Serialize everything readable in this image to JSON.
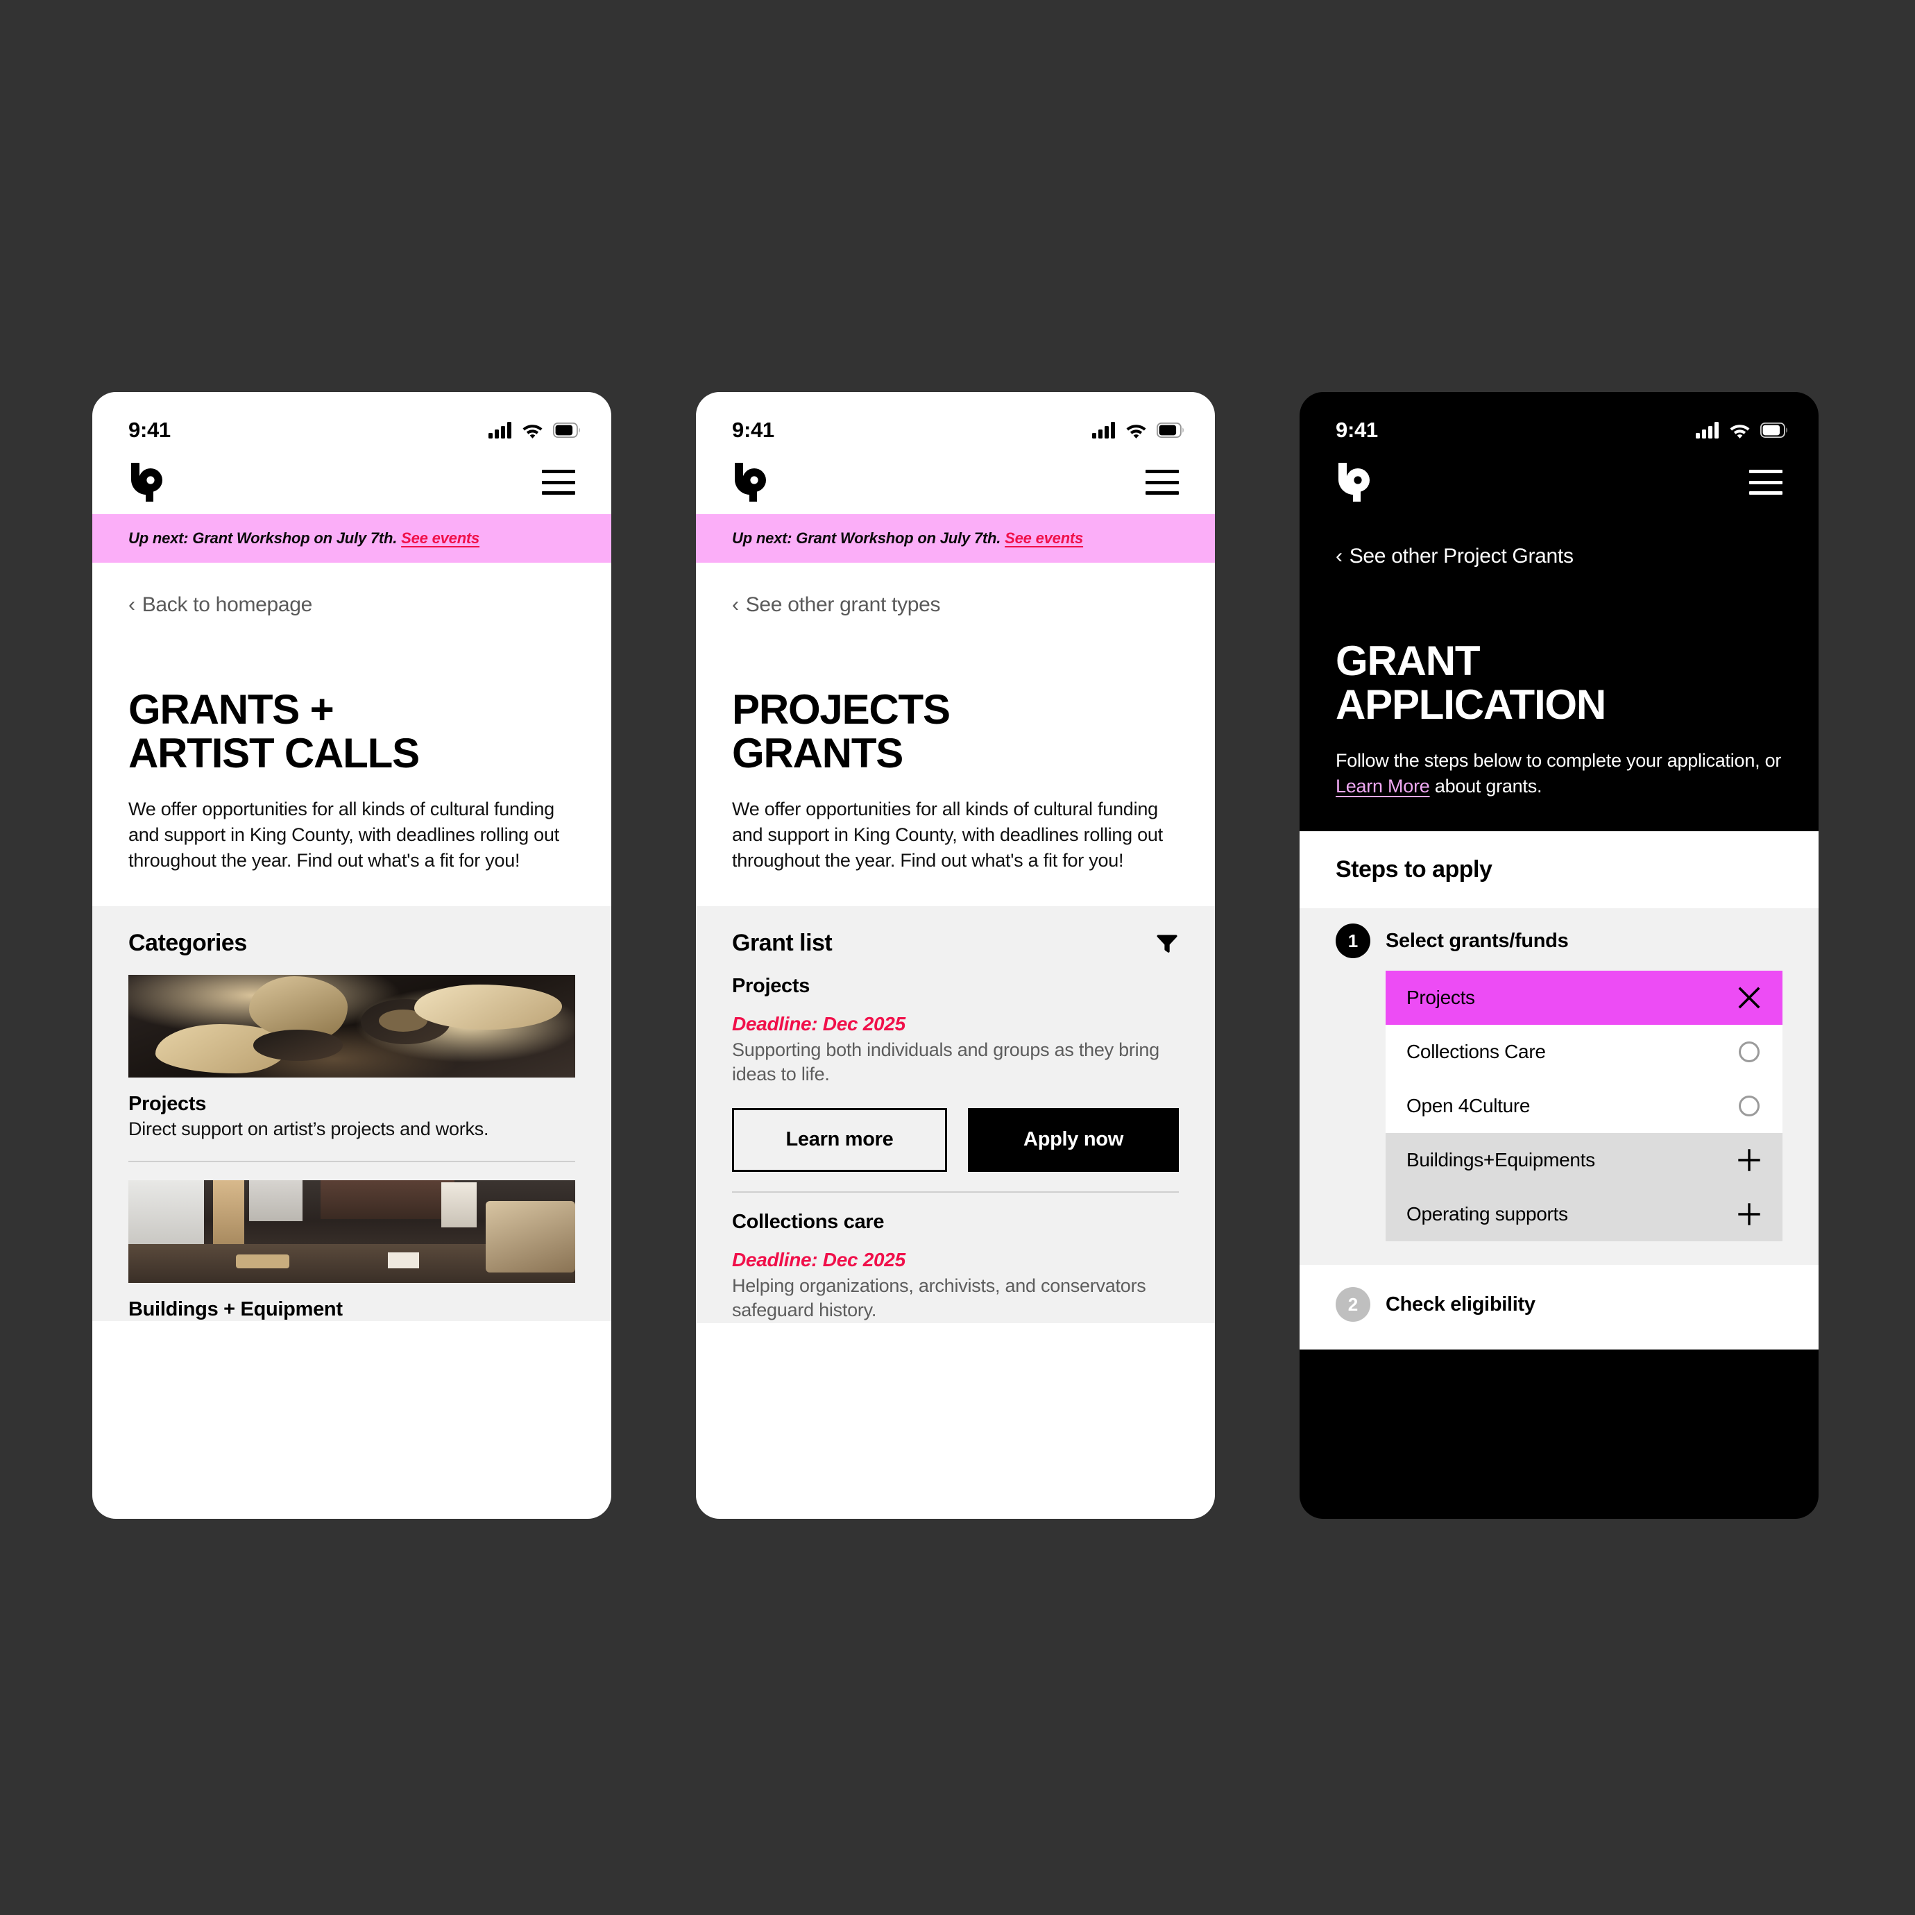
{
  "theme": {
    "canvas_bg": "#333333",
    "banner_pink": "#FBAEF8",
    "accent_magenta": "#ED4CF5",
    "accent_red": "#F0104A",
    "link_lavender": "#EFA8F2",
    "grey_section": "#F1F1F1",
    "muted_row": "#DCDCDC"
  },
  "status_bar": {
    "time": "9:41",
    "signal_icon": "cellular-signal-icon",
    "wifi_icon": "wifi-icon",
    "battery_icon": "battery-icon"
  },
  "nav": {
    "logo_icon": "4culture-logo-icon",
    "menu_icon": "hamburger-menu-icon"
  },
  "banner": {
    "text": "Up next: Grant Workshop on July 7th.",
    "link": "See events"
  },
  "screen1": {
    "back_link": "Back to homepage",
    "title": "GRANTS +\nARTIST CALLS",
    "body": "We offer opportunities for all kinds of cultural funding and support in King County, with deadlines rolling out throughout the year. Find out what's a fit for you!",
    "section_title": "Categories",
    "categories": [
      {
        "name": "Projects",
        "desc": "Direct support on artist’s projects and works.",
        "image_alt": "antique wooden shoe lasts on dark background"
      },
      {
        "name": "Buildings + Equipment",
        "desc": "",
        "image_alt": "interior renovation space with wood floor and brick wall"
      }
    ]
  },
  "screen2": {
    "back_link": "See other grant types",
    "title": "PROJECTS\nGRANTS",
    "body": "We offer opportunities for all kinds of cultural funding and support in King County, with deadlines rolling out throughout the year. Find out what's a fit for you!",
    "section_title": "Grant list",
    "filter_icon": "filter-funnel-icon",
    "grants": [
      {
        "name": "Projects",
        "deadline": "Deadline: Dec 2025",
        "desc": "Supporting both individuals and groups as they bring ideas to life.",
        "learn_more": "Learn more",
        "apply_now": "Apply now"
      },
      {
        "name": "Collections care",
        "deadline": "Deadline: Dec 2025",
        "desc": "Helping organizations, archivists, and conservators safeguard history."
      }
    ]
  },
  "screen3": {
    "back_link": "See other Project Grants",
    "title": "GRANT\nAPPLICATION",
    "body_before": "Follow the steps below to complete your application, or ",
    "body_link": "Learn More",
    "body_after": " about grants.",
    "steps_title": "Steps to apply",
    "steps": [
      {
        "number": "1",
        "label": "Select grants/funds",
        "state": "active"
      },
      {
        "number": "2",
        "label": "Check eligibility",
        "state": "inactive"
      }
    ],
    "options": [
      {
        "label": "Projects",
        "state": "selected",
        "icon": "close-x-icon"
      },
      {
        "label": "Collections Care",
        "state": "plain",
        "icon": "radio-circle-icon"
      },
      {
        "label": "Open 4Culture",
        "state": "plain",
        "icon": "radio-circle-icon"
      },
      {
        "label": "Buildings+Equipments",
        "state": "muted",
        "icon": "plus-icon"
      },
      {
        "label": "Operating supports",
        "state": "muted",
        "icon": "plus-icon"
      }
    ]
  }
}
